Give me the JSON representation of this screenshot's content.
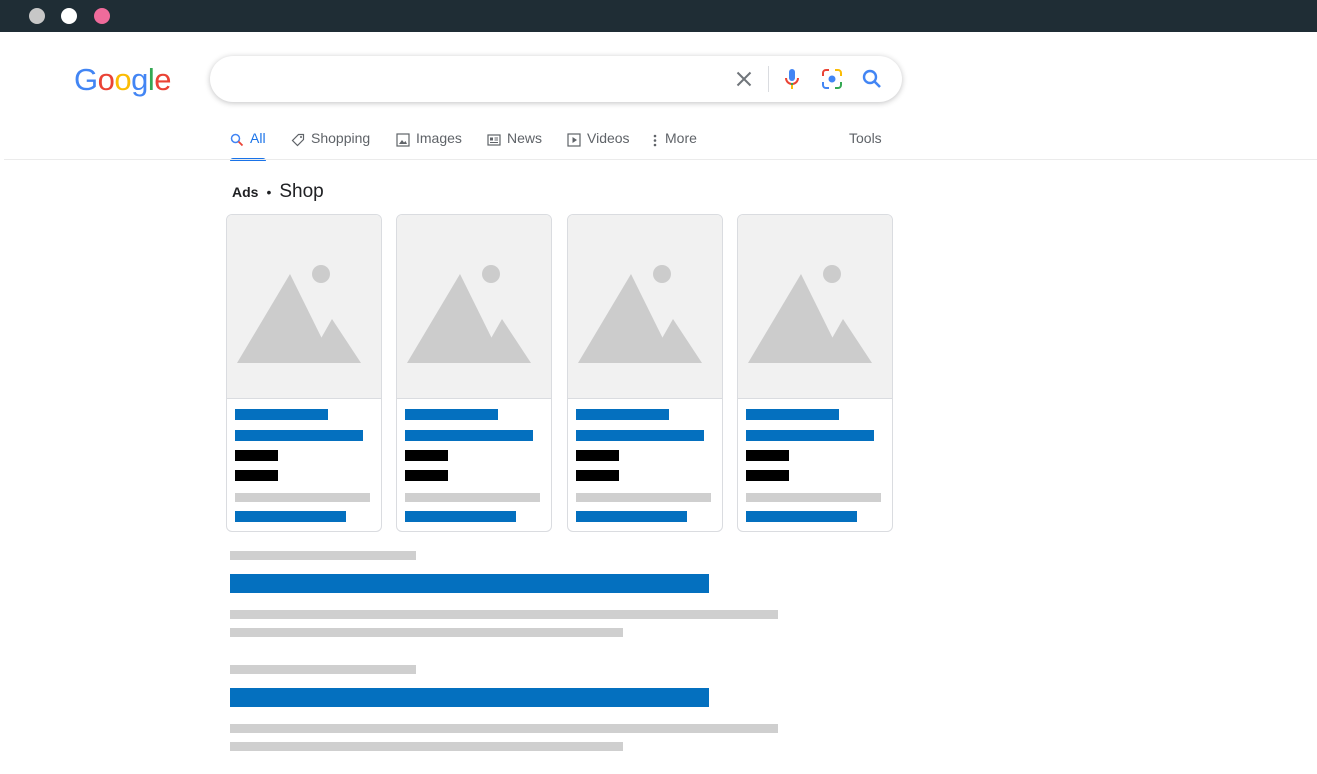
{
  "window": {
    "traffic_lights": [
      "#c7c7c7",
      "#ffffff",
      "#ef6b9b"
    ]
  },
  "logo": {
    "letters": [
      "G",
      "o",
      "o",
      "g",
      "l",
      "e"
    ],
    "colors": [
      "#4285f4",
      "#ea4335",
      "#fbbc05",
      "#4285f4",
      "#34a853",
      "#ea4335"
    ]
  },
  "search": {
    "value": "",
    "placeholder": "",
    "icons": [
      "close-icon",
      "mic-icon",
      "camera-lens-icon",
      "search-icon"
    ]
  },
  "tabs": [
    {
      "label": "All",
      "icon": "search-icon",
      "active": true
    },
    {
      "label": "Shopping",
      "icon": "tag-icon",
      "active": false
    },
    {
      "label": "Images",
      "icon": "image-icon",
      "active": false
    },
    {
      "label": "News",
      "icon": "news-icon",
      "active": false
    },
    {
      "label": "Videos",
      "icon": "play-icon",
      "active": false
    },
    {
      "label": "More",
      "icon": "more-vert-icon",
      "active": false
    }
  ],
  "tools_label": "Tools",
  "ads": {
    "label": "Ads",
    "separator": "•",
    "title": "Shop"
  },
  "product_cards": [
    {
      "image": "image-placeholder-icon"
    },
    {
      "image": "image-placeholder-icon"
    },
    {
      "image": "image-placeholder-icon"
    },
    {
      "image": "image-placeholder-icon"
    }
  ],
  "colors": {
    "link": "#0470bf",
    "placeholder_text": "#cfcfcf",
    "accent": "#1a73e8",
    "titlebar": "#1f2d35"
  }
}
